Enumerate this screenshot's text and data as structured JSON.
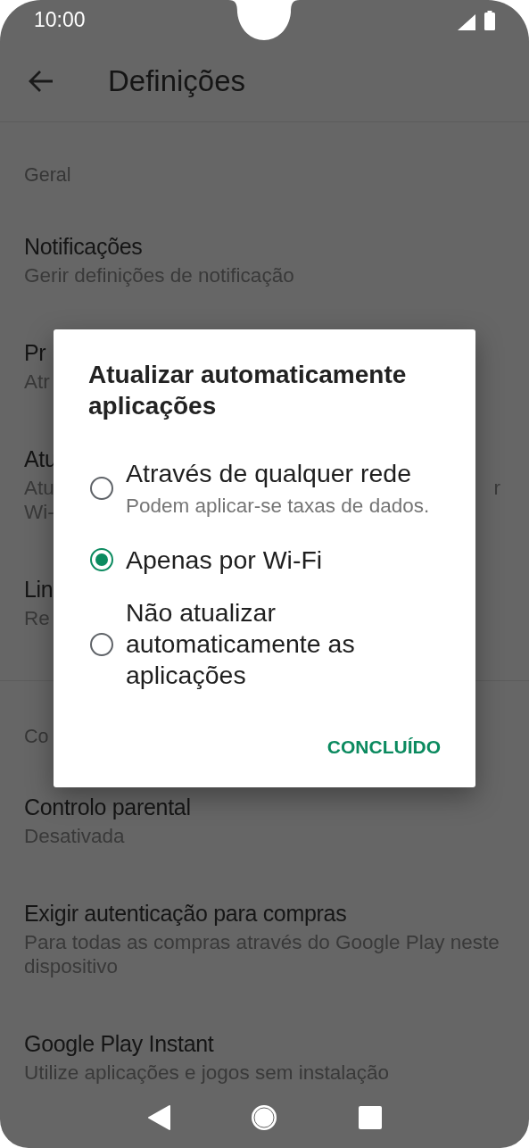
{
  "status_bar": {
    "time": "10:00"
  },
  "app_bar": {
    "title": "Definições"
  },
  "sections": [
    {
      "header": "Geral",
      "items": [
        {
          "title": "Notificações",
          "subtitle": [
            "Gerir definições de notificação"
          ]
        },
        {
          "title": "Pr",
          "subtitle": [
            "Atr"
          ]
        },
        {
          "title": "Atu",
          "subtitle": [
            "Atu",
            "Wi-"
          ],
          "subtitle_tail": "r"
        },
        {
          "title": "Lin",
          "subtitle": [
            "Re"
          ]
        }
      ]
    },
    {
      "header": "Co",
      "items": [
        {
          "title": "Controlo parental",
          "subtitle": [
            "Desativada"
          ]
        },
        {
          "title": "Exigir autenticação para compras",
          "subtitle": [
            "Para todas as compras através do Google Play neste dispositivo"
          ]
        },
        {
          "title": "Google Play Instant",
          "subtitle": [
            "Utilize aplicações e jogos sem instalação"
          ]
        }
      ]
    }
  ],
  "dialog": {
    "title": "Atualizar automaticamente aplicações",
    "options": [
      {
        "label": "Através de qualquer rede",
        "sublabel": "Podem aplicar-se taxas de dados.",
        "selected": false
      },
      {
        "label": "Apenas por Wi-Fi",
        "selected": true
      },
      {
        "label": "Não atualizar automaticamente as aplicações",
        "selected": false
      }
    ],
    "button": "CONCLUÍDO"
  }
}
